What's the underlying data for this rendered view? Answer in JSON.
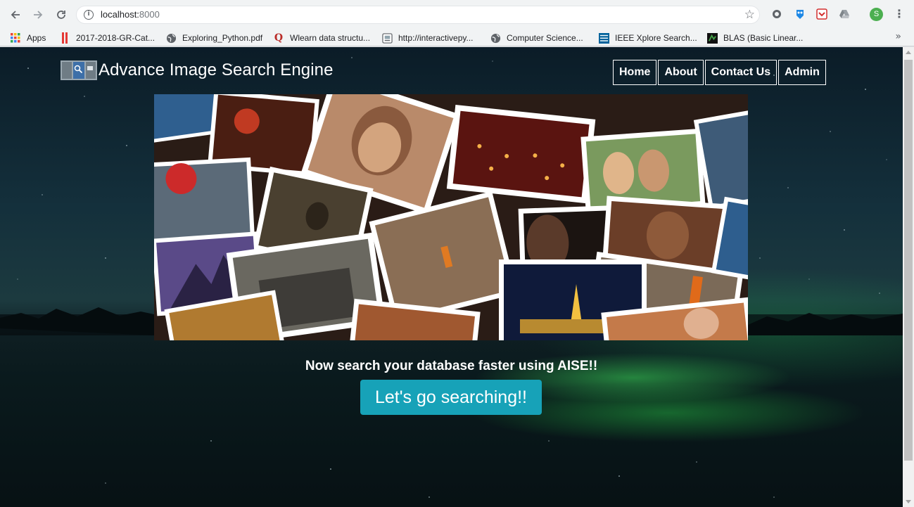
{
  "browser": {
    "url_host": "localhost:",
    "url_port": "8000",
    "profile_initial": "S",
    "bookmarks": [
      {
        "label": "Apps",
        "icon": "apps-grid-icon"
      },
      {
        "label": "2017-2018-GR-Cat...",
        "icon": "bookmark-red-icon"
      },
      {
        "label": "Exploring_Python.pdf",
        "icon": "globe-icon"
      },
      {
        "label": "Wlearn data structu...",
        "icon": "quora-icon"
      },
      {
        "label": "http://interactivepy...",
        "icon": "page-icon"
      },
      {
        "label": "Computer Science...",
        "icon": "globe-icon"
      },
      {
        "label": "IEEE Xplore Search...",
        "icon": "ieee-icon"
      },
      {
        "label": "BLAS (Basic Linear...",
        "icon": "blas-icon"
      }
    ],
    "more_bookmarks": "»"
  },
  "page": {
    "brand_title": "Advance Image Search Engine",
    "nav": [
      "Home",
      "About",
      "Contact Us",
      "Admin"
    ],
    "tagline": "Now search your database faster using AISE!!",
    "cta_label": "Let's go searching!!",
    "colors": {
      "cta": "#17a2b8",
      "nav_border": "#ffffff"
    }
  }
}
